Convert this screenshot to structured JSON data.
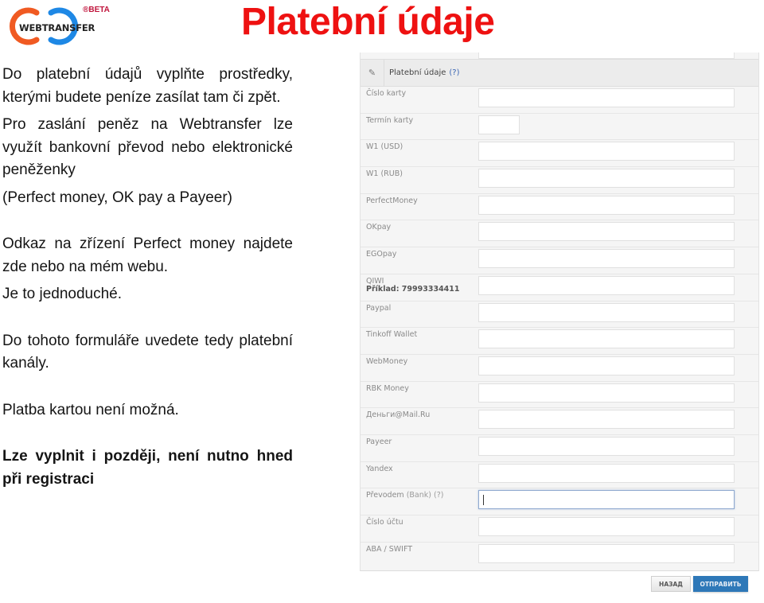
{
  "logo": {
    "brand": "WEBTRANSFER",
    "badge": "®BETA",
    "colors": {
      "left_ring": "#f05a22",
      "right_ring": "#1e88e5",
      "badge": "#c0143c"
    }
  },
  "slide": {
    "title": "Platební údaje",
    "title_color": "#ee1111"
  },
  "left_text": {
    "p1": "Do platební údajů vyplňte prostředky, kterými budete peníze zasílat tam či zpět.",
    "p2": "Pro zaslání peněz na Webtransfer lze využít bankovní převod nebo elektronické peněženky",
    "p3": "(Perfect money, OK pay a Payeer)",
    "p4": "Odkaz na zřízení Perfect money najdete zde nebo na mém webu.",
    "p5": "Je to jednoduché.",
    "p6": "Do tohoto formuláře uvedete tedy platební kanály.",
    "p7": "Platba kartou není možná.",
    "p8": "Lze vyplnit i později, není nutno hned při registraci"
  },
  "form": {
    "section_title": "Platební údaje",
    "section_help": "(?)",
    "fields": [
      {
        "label": "Číslo karty",
        "value": ""
      },
      {
        "label": "Termín karty",
        "value": ""
      },
      {
        "label": "W1 (USD)",
        "value": ""
      },
      {
        "label": "W1 (RUB)",
        "value": ""
      },
      {
        "label": "PerfectMoney",
        "value": ""
      },
      {
        "label": "OKpay",
        "value": ""
      },
      {
        "label": "EGOpay",
        "value": ""
      },
      {
        "label": "QIWI",
        "sublabel": "Příklad: 79993334411",
        "value": ""
      },
      {
        "label": "Paypal",
        "value": ""
      },
      {
        "label": "Tinkoff Wallet",
        "value": ""
      },
      {
        "label": "WebMoney",
        "value": ""
      },
      {
        "label": "RBK Money",
        "value": ""
      },
      {
        "label": "Деньги@Mail.Ru",
        "value": ""
      },
      {
        "label": "Payeer",
        "value": ""
      },
      {
        "label": "Yandex",
        "value": ""
      },
      {
        "label": "Převodem",
        "hint": "(Bank) (?)",
        "value": ""
      },
      {
        "label": "Číslo účtu",
        "value": ""
      },
      {
        "label": "ABA / SWIFT",
        "value": ""
      }
    ],
    "buttons": {
      "back": "НАЗАД",
      "submit": "ОТПРАВИТЬ"
    },
    "accent_color": "#2e78b8"
  }
}
